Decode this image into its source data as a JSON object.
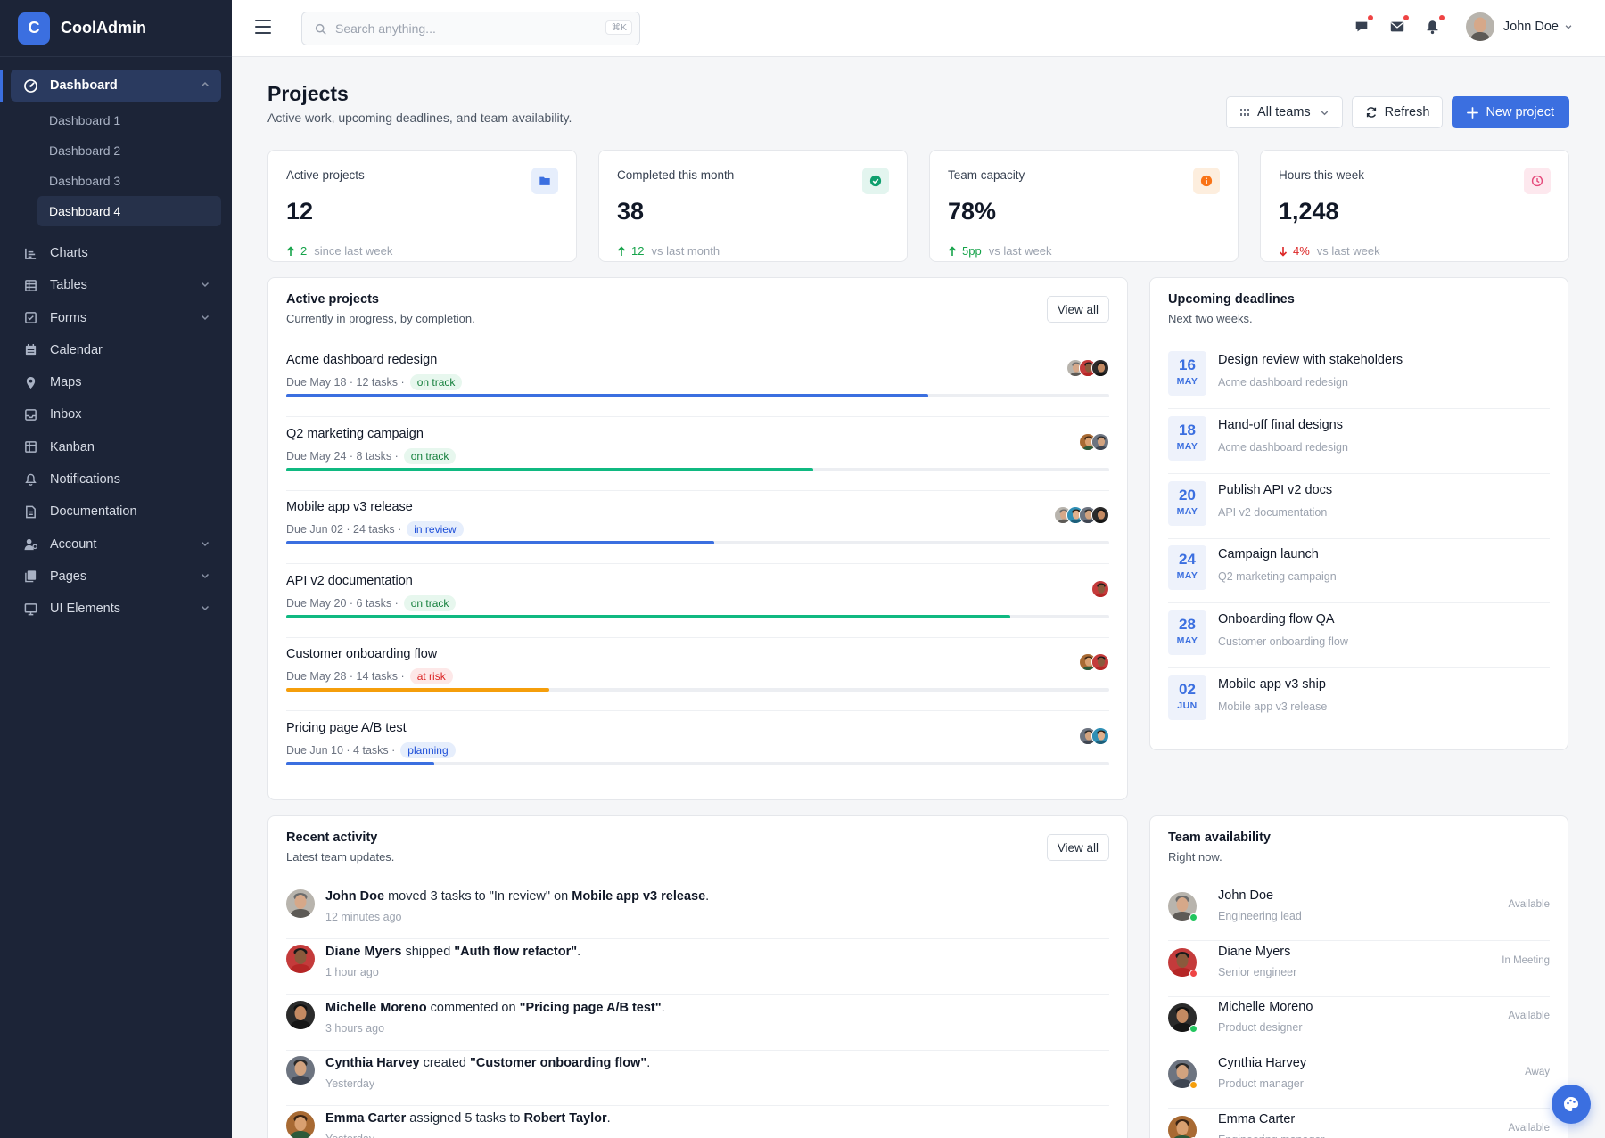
{
  "brand": {
    "letter": "C",
    "name": "CoolAdmin"
  },
  "sidebar": {
    "dashboard_label": "Dashboard",
    "sub_items": [
      "Dashboard 1",
      "Dashboard 2",
      "Dashboard 3",
      "Dashboard 4"
    ],
    "items": [
      {
        "label": "Charts",
        "icon": "chart-icon"
      },
      {
        "label": "Tables",
        "icon": "table-icon"
      },
      {
        "label": "Forms",
        "icon": "form-icon"
      },
      {
        "label": "Calendar",
        "icon": "calendar-icon"
      },
      {
        "label": "Maps",
        "icon": "map-pin-icon"
      },
      {
        "label": "Inbox",
        "icon": "inbox-icon"
      },
      {
        "label": "Kanban",
        "icon": "kanban-icon"
      },
      {
        "label": "Notifications",
        "icon": "bell-icon"
      },
      {
        "label": "Documentation",
        "icon": "document-icon"
      },
      {
        "label": "Account",
        "icon": "user-icon"
      },
      {
        "label": "Pages",
        "icon": "pages-icon"
      },
      {
        "label": "UI Elements",
        "icon": "monitor-icon"
      }
    ]
  },
  "topbar": {
    "search_placeholder": "Search anything...",
    "search_shortcut": "⌘K",
    "user_name": "John Doe"
  },
  "page": {
    "title": "Projects",
    "subtitle": "Active work, upcoming deadlines, and team availability.",
    "filter_label": "All teams",
    "refresh_label": "Refresh",
    "new_label": "New project"
  },
  "stats": [
    {
      "label": "Active projects",
      "value": "12",
      "delta": "2",
      "note": "since last week",
      "dir": "up",
      "icon": "folder-icon",
      "icon_bg": "#e6eefc",
      "icon_color": "#3b6fe0"
    },
    {
      "label": "Completed this month",
      "value": "38",
      "delta": "12",
      "note": "vs last month",
      "dir": "up",
      "icon": "check-circle-icon",
      "icon_bg": "#e3f5ef",
      "icon_color": "#0f9f6e"
    },
    {
      "label": "Team capacity",
      "value": "78%",
      "delta": "5pp",
      "note": "vs last week",
      "dir": "up",
      "icon": "info-icon",
      "icon_bg": "#fdeede",
      "icon_color": "#f97316"
    },
    {
      "label": "Hours this week",
      "value": "1,248",
      "delta": "4%",
      "note": "vs last week",
      "dir": "down",
      "icon": "clock-icon",
      "icon_bg": "#fde8ee",
      "icon_color": "#e5487a"
    }
  ],
  "active_projects": {
    "title": "Active projects",
    "subtitle": "Currently in progress, by completion.",
    "view_all": "View all",
    "items": [
      {
        "name": "Acme dashboard redesign",
        "meta": "Due May 18 · 12 tasks ·",
        "tag": "on track",
        "tag_class": "on-track",
        "progress": 0.78,
        "color": "#3b6fe0",
        "avatars": 3
      },
      {
        "name": "Q2 marketing campaign",
        "meta": "Due May 24 · 8 tasks ·",
        "tag": "on track",
        "tag_class": "on-track",
        "progress": 0.64,
        "color": "#10b981",
        "avatars": 2
      },
      {
        "name": "Mobile app v3 release",
        "meta": "Due Jun 02 · 24 tasks ·",
        "tag": "in review",
        "tag_class": "in-review",
        "progress": 0.52,
        "color": "#3b6fe0",
        "avatars": 4
      },
      {
        "name": "API v2 documentation",
        "meta": "Due May 20 · 6 tasks ·",
        "tag": "on track",
        "tag_class": "on-track",
        "progress": 0.88,
        "color": "#10b981",
        "avatars": 1
      },
      {
        "name": "Customer onboarding flow",
        "meta": "Due May 28 · 14 tasks ·",
        "tag": "at risk",
        "tag_class": "at-risk",
        "progress": 0.32,
        "color": "#f59e0b",
        "avatars": 2
      },
      {
        "name": "Pricing page A/B test",
        "meta": "Due Jun 10 · 4 tasks ·",
        "tag": "planning",
        "tag_class": "planning",
        "progress": 0.18,
        "color": "#3b6fe0",
        "avatars": 2
      }
    ]
  },
  "deadlines": {
    "title": "Upcoming deadlines",
    "subtitle": "Next two weeks.",
    "items": [
      {
        "day": "16",
        "mon": "MAY",
        "title": "Design review with stakeholders",
        "project": "Acme dashboard redesign"
      },
      {
        "day": "18",
        "mon": "MAY",
        "title": "Hand-off final designs",
        "project": "Acme dashboard redesign"
      },
      {
        "day": "20",
        "mon": "MAY",
        "title": "Publish API v2 docs",
        "project": "API v2 documentation"
      },
      {
        "day": "24",
        "mon": "MAY",
        "title": "Campaign launch",
        "project": "Q2 marketing campaign"
      },
      {
        "day": "28",
        "mon": "MAY",
        "title": "Onboarding flow QA",
        "project": "Customer onboarding flow"
      },
      {
        "day": "02",
        "mon": "JUN",
        "title": "Mobile app v3 ship",
        "project": "Mobile app v3 release"
      }
    ]
  },
  "activity": {
    "title": "Recent activity",
    "subtitle": "Latest team updates.",
    "view_all": "View all",
    "items": [
      {
        "who": "John Doe",
        "mid": " moved 3 tasks to \"In review\" on ",
        "obj": "Mobile app v3 release",
        "end": ".",
        "time": "12 minutes ago"
      },
      {
        "who": "Diane Myers",
        "mid": " shipped ",
        "obj": "\"Auth flow refactor\"",
        "end": ".",
        "time": "1 hour ago"
      },
      {
        "who": "Michelle Moreno",
        "mid": " commented on ",
        "obj": "\"Pricing page A/B test\"",
        "end": ".",
        "time": "3 hours ago"
      },
      {
        "who": "Cynthia Harvey",
        "mid": " created ",
        "obj": "\"Customer onboarding flow\"",
        "end": ".",
        "time": "Yesterday"
      },
      {
        "who": "Emma Carter",
        "mid": " assigned 5 tasks to ",
        "obj": "Robert Taylor",
        "end": ".",
        "time": "Yesterday"
      }
    ]
  },
  "team": {
    "title": "Team availability",
    "subtitle": "Right now.",
    "items": [
      {
        "name": "John Doe",
        "role": "Engineering lead",
        "state": "Available",
        "status_color": "#22c55e"
      },
      {
        "name": "Diane Myers",
        "role": "Senior engineer",
        "state": "In Meeting",
        "status_color": "#ef4444"
      },
      {
        "name": "Michelle Moreno",
        "role": "Product designer",
        "state": "Available",
        "status_color": "#22c55e"
      },
      {
        "name": "Cynthia Harvey",
        "role": "Product manager",
        "state": "Away",
        "status_color": "#f59e0b"
      },
      {
        "name": "Emma Carter",
        "role": "Engineering manager",
        "state": "Available",
        "status_color": "#22c55e"
      }
    ]
  }
}
